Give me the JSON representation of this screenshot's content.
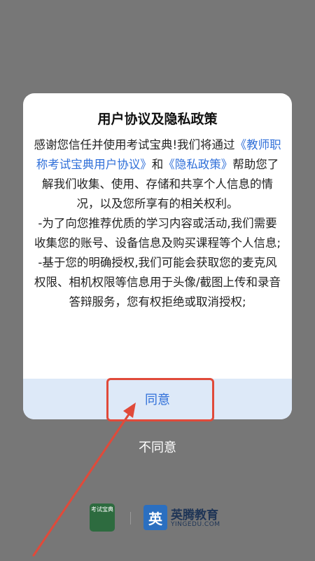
{
  "dialog": {
    "title": "用户协议及隐私政策",
    "intro_pre": "感谢您信任并使用考试宝典!我们将通过",
    "link_user_agreement": "《教师职称考试宝典用户协议》",
    "intro_and": "和",
    "link_privacy": "《隐私政策》",
    "intro_post": "帮助您了解我们收集、使用、存储和共享个人信息的情况，以及您所享有的相关权利。",
    "item1": "-为了向您推荐优质的学习内容或活动,我们需要收集您的账号、设备信息及购买课程等个人信息;",
    "item2": "-基于您的明确授权,我们可能会获取您的麦克风权限、相机权限等信息用于头像/截图上传和录音答辩服务，您有权拒绝或取消授权;",
    "agree_label": "同意",
    "disagree_label": "不同意"
  },
  "footer": {
    "logo1_text": "考试宝典",
    "logo2_char": "英",
    "brand_cn": "英腾教育",
    "brand_en": "YINGEDU.COM"
  },
  "colors": {
    "overlay": "#777777",
    "link": "#2f6fd9",
    "agree_bg": "#dde9f8",
    "annotation": "#e04a3a"
  }
}
